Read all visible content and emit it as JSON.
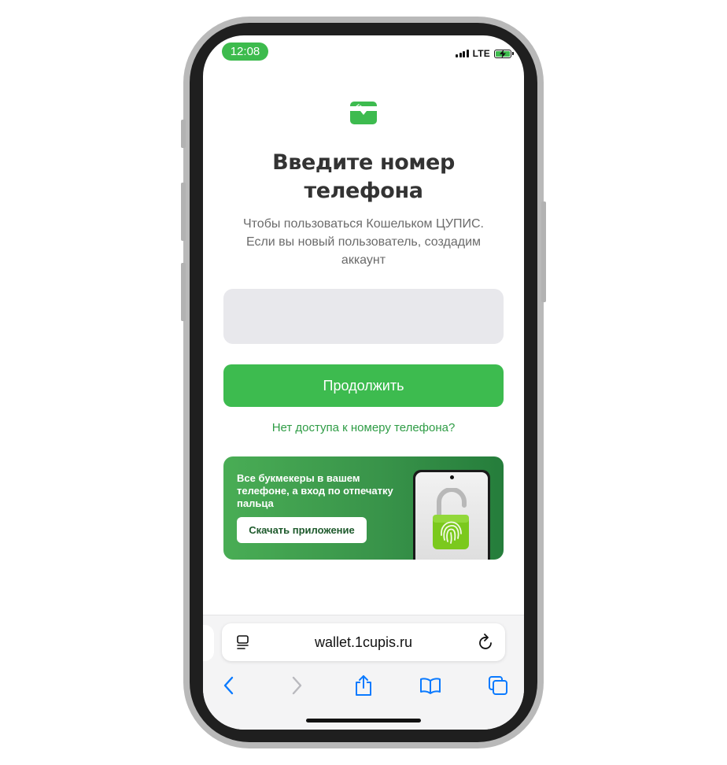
{
  "status_bar": {
    "time": "12:08",
    "network": "LTE",
    "battery_level": 1.0,
    "battery_charging": true,
    "signal_bars": 4
  },
  "app": {
    "logo_icon": "wallet-icon",
    "title": "Введите номер телефона",
    "subtitle": "Чтобы пользоваться Кошельком ЦУПИС. Если вы новый пользователь, создадим аккаунт",
    "phone_input": {
      "value": "",
      "placeholder": ""
    },
    "continue_label": "Продолжить",
    "no_access_link": "Нет доступа к номеру телефона?"
  },
  "promo": {
    "text": "Все букмекеры в вашем телефоне, а вход по отпечатку пальца",
    "button_label": "Скачать приложение",
    "image_icon": "fingerprint-lock-icon"
  },
  "browser": {
    "url": "wallet.1cupis.ru",
    "toolbar_icons": [
      "back-icon",
      "forward-icon",
      "share-icon",
      "bookmarks-icon",
      "tabs-icon"
    ]
  },
  "colors": {
    "accent": "#3dbb4f",
    "link": "#2e9c45",
    "ios_blue": "#0a7aff",
    "title": "#333333",
    "subtitle": "#6b6b6b"
  }
}
